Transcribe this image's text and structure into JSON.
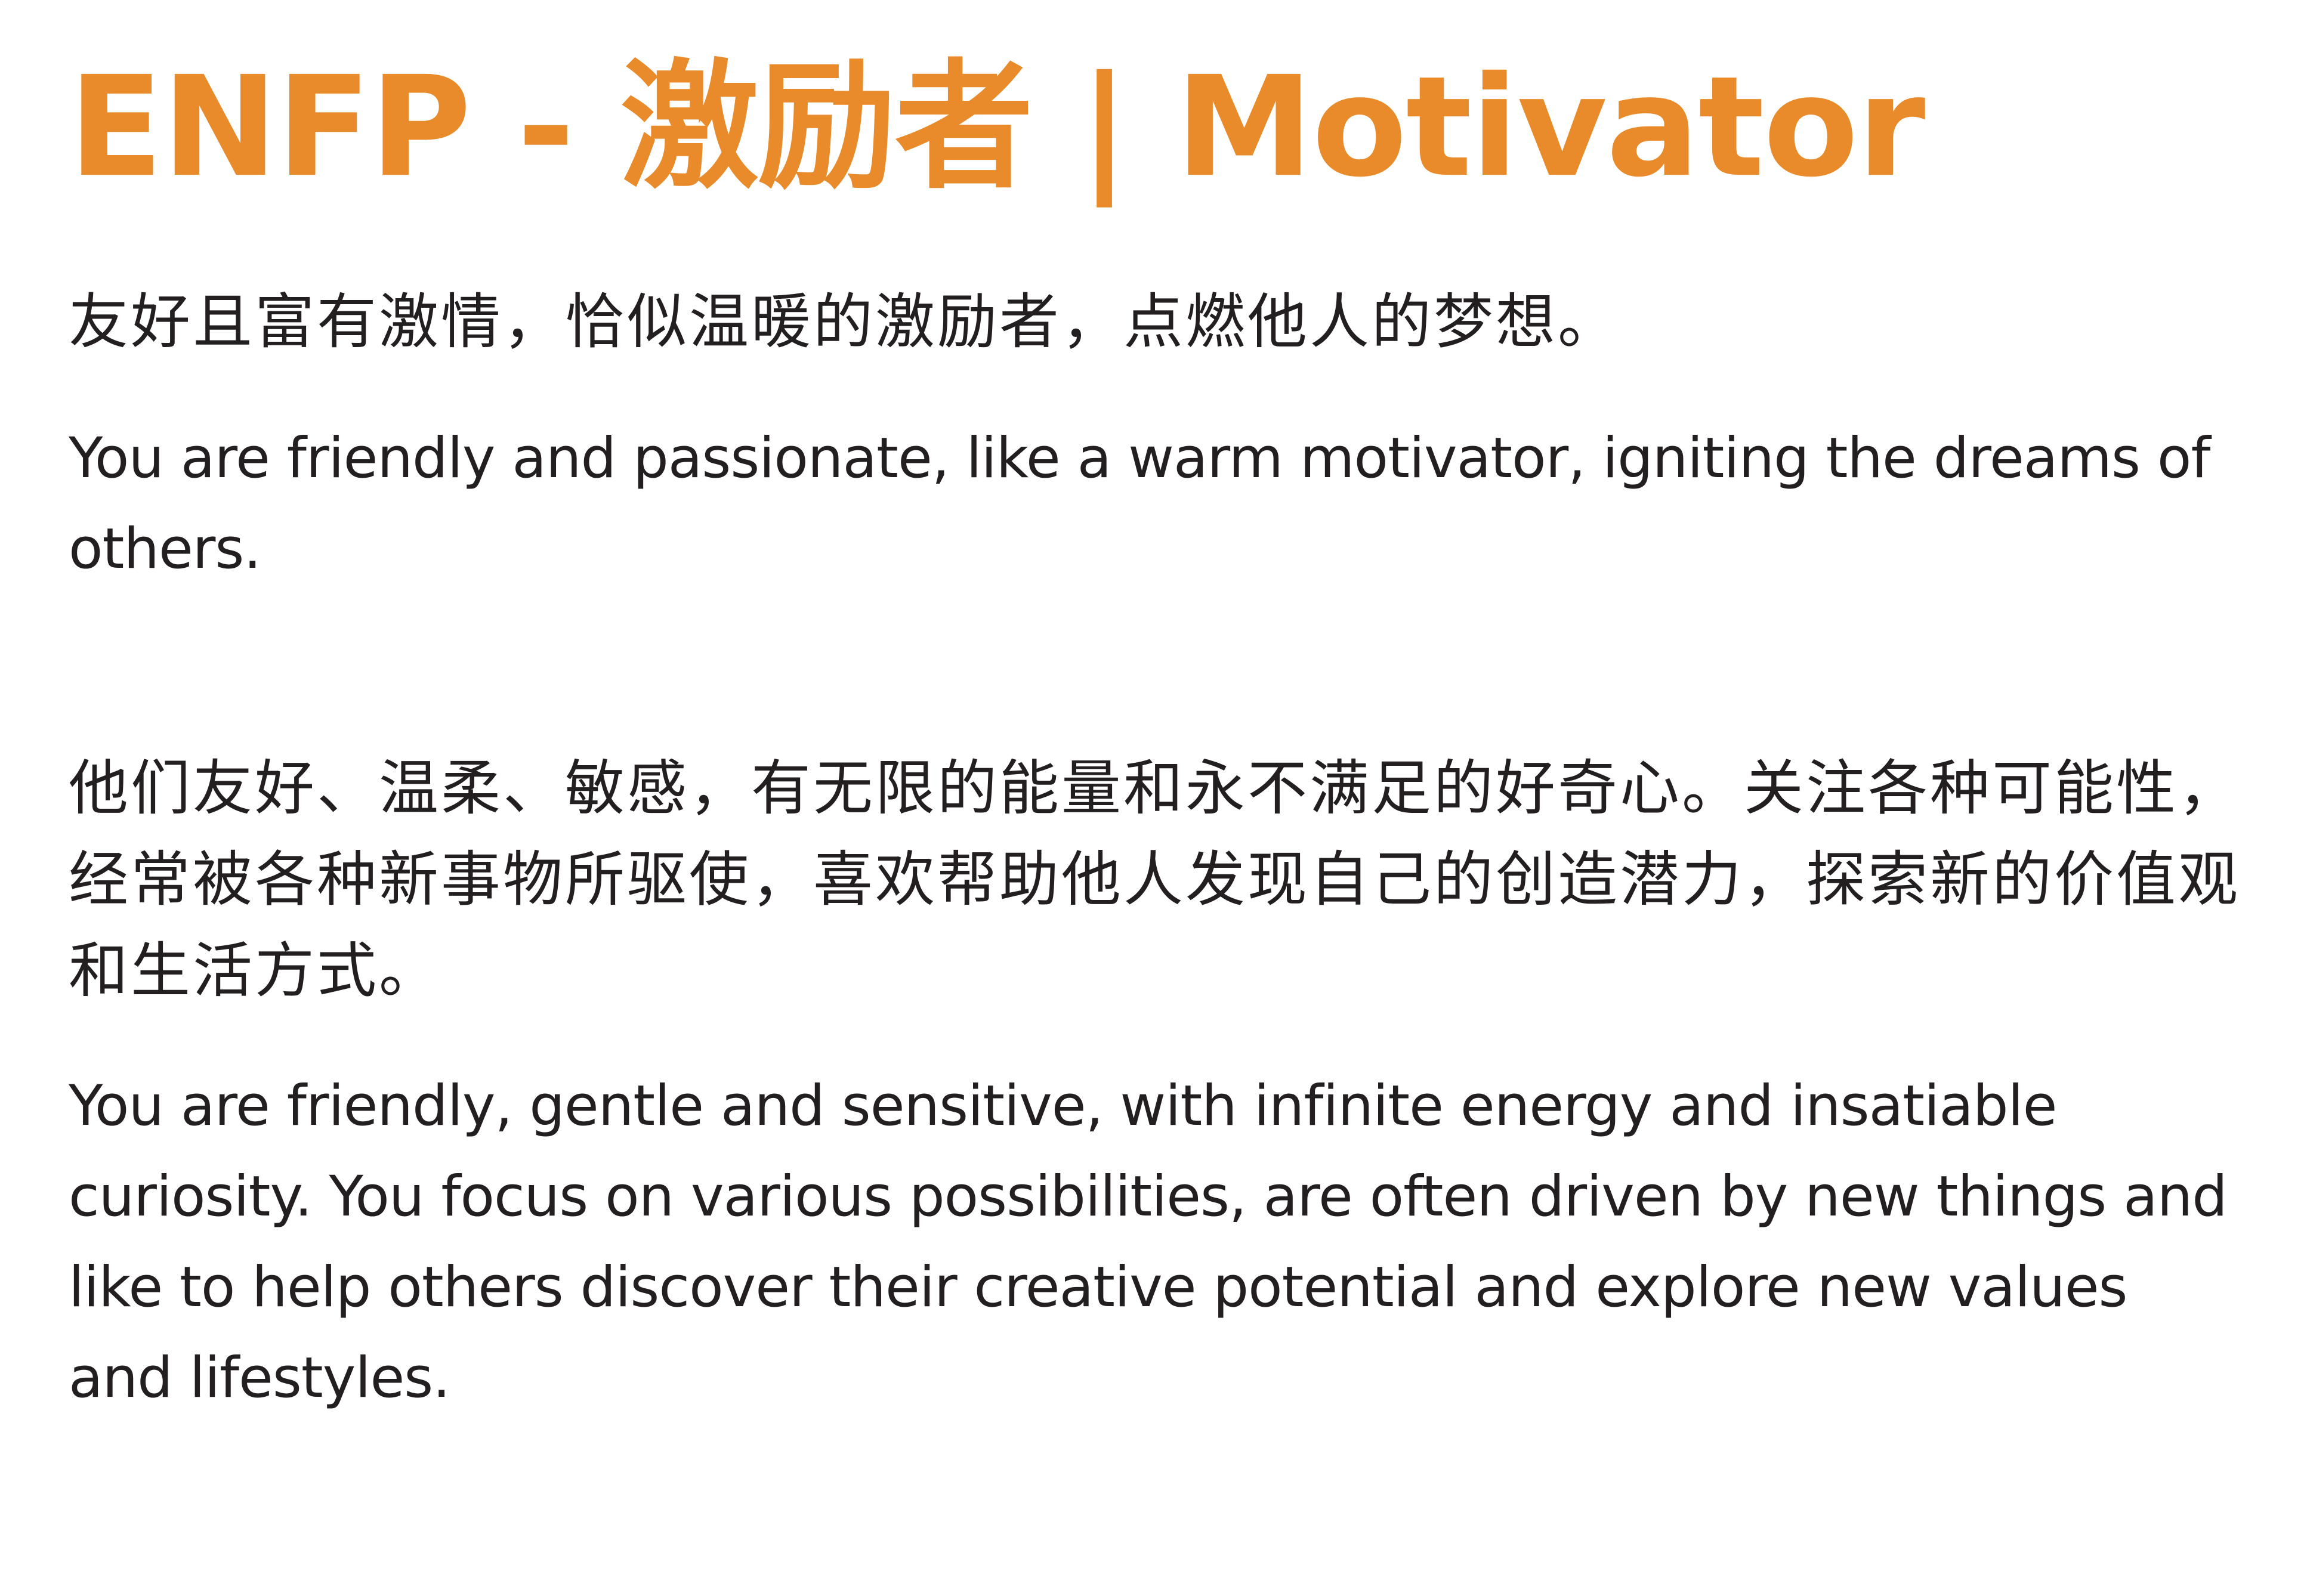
{
  "title": {
    "text": "ENFP - 激励者 | Motivator",
    "color": "#e98b2a"
  },
  "text_color": "#231f20",
  "intro": {
    "chinese": "友好且富有激情，恰似温暖的激励者，点燃他人的梦想。",
    "english": "You are friendly and passionate, like a warm motivator, igniting the dreams of others."
  },
  "description": {
    "chinese": "他们友好、温柔、敏感，有无限的能量和永不满足的好奇心。关注各种可能性，经常被各种新事物所驱使，喜欢帮助他人发现自己的创造潜力，探索新的价值观和生活方式。",
    "english": "You are friendly, gentle and sensitive, with infinite energy and insatiable curiosity. You focus on various possibilities, are often driven by new things and like to help others discover their creative potential and explore new values and lifestyles."
  }
}
